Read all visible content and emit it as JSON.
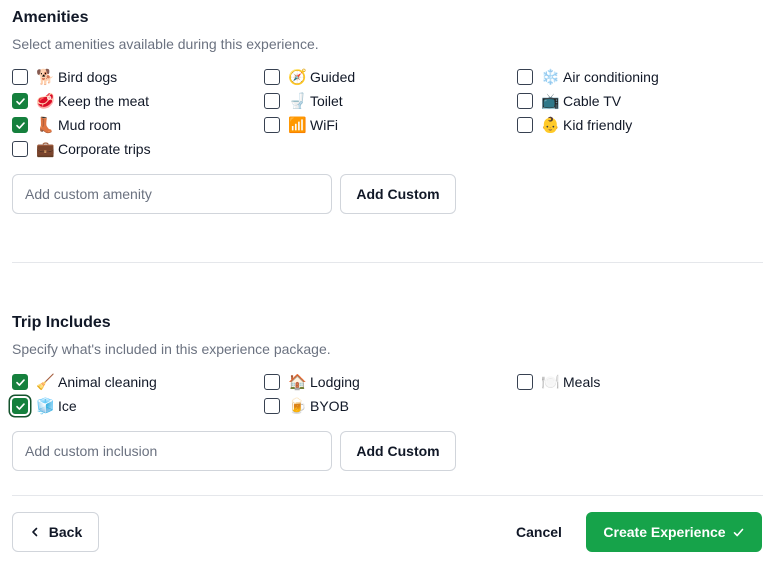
{
  "amenities": {
    "title": "Amenities",
    "description": "Select amenities available during this experience.",
    "options": [
      {
        "emoji": "🐕",
        "icon": "dog-icon",
        "label": "Bird dogs",
        "checked": false
      },
      {
        "emoji": "🧭",
        "icon": "compass-icon",
        "label": "Guided",
        "checked": false
      },
      {
        "emoji": "❄️",
        "icon": "snowflake-icon",
        "label": "Air conditioning",
        "checked": false
      },
      {
        "emoji": "🥩",
        "icon": "meat-icon",
        "label": "Keep the meat",
        "checked": true
      },
      {
        "emoji": "🚽",
        "icon": "toilet-icon",
        "label": "Toilet",
        "checked": false
      },
      {
        "emoji": "📺",
        "icon": "tv-icon",
        "label": "Cable TV",
        "checked": false
      },
      {
        "emoji": "👢",
        "icon": "boot-icon",
        "label": "Mud room",
        "checked": true
      },
      {
        "emoji": "📶",
        "icon": "wifi-icon",
        "label": "WiFi",
        "checked": false
      },
      {
        "emoji": "👶",
        "icon": "baby-icon",
        "label": "Kid friendly",
        "checked": false
      },
      {
        "emoji": "💼",
        "icon": "briefcase-icon",
        "label": "Corporate trips",
        "checked": false
      }
    ],
    "custom_placeholder": "Add custom amenity",
    "custom_value": "",
    "add_button": "Add Custom"
  },
  "includes": {
    "title": "Trip Includes",
    "description": "Specify what's included in this experience package.",
    "options": [
      {
        "emoji": "🧹",
        "icon": "broom-icon",
        "label": "Animal cleaning",
        "checked": true
      },
      {
        "emoji": "🏠",
        "icon": "house-icon",
        "label": "Lodging",
        "checked": false
      },
      {
        "emoji": "🍽️",
        "icon": "plate-icon",
        "label": "Meals",
        "checked": false
      },
      {
        "emoji": "🧊",
        "icon": "ice-icon",
        "label": "Ice",
        "checked": true,
        "focused": true
      },
      {
        "emoji": "🍺",
        "icon": "beer-icon",
        "label": "BYOB",
        "checked": false
      }
    ],
    "custom_placeholder": "Add custom inclusion",
    "custom_value": "",
    "add_button": "Add Custom"
  },
  "footer": {
    "back": "Back",
    "cancel": "Cancel",
    "create": "Create Experience"
  },
  "colors": {
    "primary": "#16a34a",
    "checkbox_checked": "#15803d",
    "muted_text": "#6b7280",
    "border": "#d1d5db"
  }
}
